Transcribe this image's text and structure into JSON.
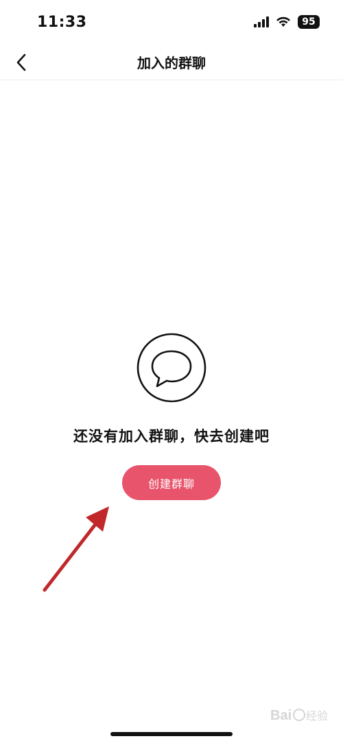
{
  "status_bar": {
    "time": "11:33",
    "battery": "95",
    "icons": [
      "signal-icon",
      "wifi-icon",
      "battery-icon"
    ]
  },
  "nav": {
    "title": "加入的群聊",
    "back_icon": "chevron-left-icon"
  },
  "empty_state": {
    "icon": "chat-bubble-icon",
    "message": "还没有加入群聊，快去创建吧",
    "button_label": "创建群聊"
  },
  "colors": {
    "accent": "#e8546b",
    "annotation_arrow": "#c0282a",
    "text": "#111111",
    "background": "#ffffff"
  },
  "watermark": {
    "text": "Bai 经验"
  }
}
